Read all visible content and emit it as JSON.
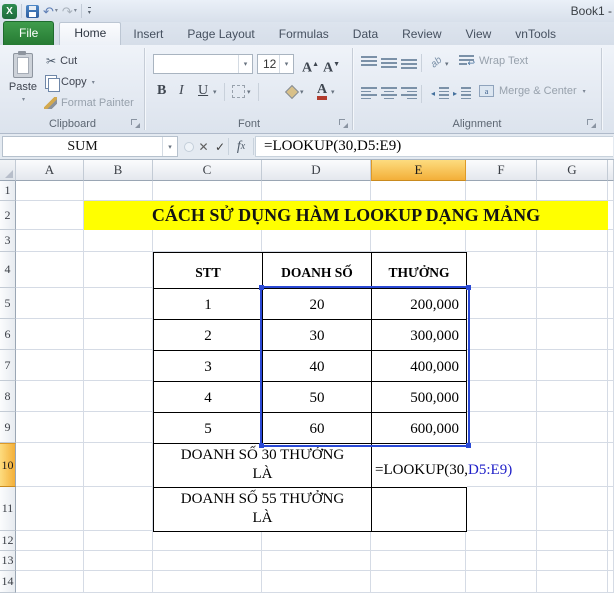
{
  "window": {
    "title": "Book1 -"
  },
  "icons": {
    "excel_logo": "X",
    "save": "floppy-disk",
    "undo": "↶",
    "redo": "↷",
    "qat_dropdown": "▾",
    "dropdown": "▾",
    "scissors": "✂",
    "cancel": "✕",
    "enter": "✓",
    "function": "fx",
    "bold": "B",
    "italic": "I",
    "underline": "U"
  },
  "tabs": {
    "items": [
      {
        "label": "File",
        "file": true,
        "active": false
      },
      {
        "label": "Home",
        "file": false,
        "active": true
      },
      {
        "label": "Insert",
        "file": false,
        "active": false
      },
      {
        "label": "Page Layout",
        "file": false,
        "active": false
      },
      {
        "label": "Formulas",
        "file": false,
        "active": false
      },
      {
        "label": "Data",
        "file": false,
        "active": false
      },
      {
        "label": "Review",
        "file": false,
        "active": false
      },
      {
        "label": "View",
        "file": false,
        "active": false
      },
      {
        "label": "vnTools",
        "file": false,
        "active": false
      }
    ]
  },
  "ribbon": {
    "clipboard": {
      "label": "Clipboard",
      "paste": "Paste",
      "cut": "Cut",
      "copy": "Copy",
      "format_painter": "Format Painter"
    },
    "font": {
      "label": "Font",
      "size_value": "12",
      "name_value": ""
    },
    "alignment": {
      "label": "Alignment",
      "wrap_text": "Wrap Text",
      "merge_center": "Merge & Center",
      "orientation": "ab"
    }
  },
  "formula_bar": {
    "name_box": "SUM",
    "formula": "=LOOKUP(30,D5:E9)"
  },
  "sheet": {
    "column_headers": [
      "A",
      "B",
      "C",
      "D",
      "E",
      "F",
      "G"
    ],
    "row_headers": [
      "1",
      "2",
      "3",
      "4",
      "5",
      "6",
      "7",
      "8",
      "9",
      "10",
      "11",
      "12",
      "13",
      "14"
    ],
    "active_column": "E",
    "active_row": "10",
    "highlight_range": "D5:E9",
    "banner": {
      "text": "CÁCH SỬ DỤNG HÀM LOOKUP DẠNG MẢNG",
      "bg_color": "#FFFF00",
      "text_color": "#141414"
    },
    "table": {
      "headers": [
        "STT",
        "DOANH SỐ",
        "THƯỞNG"
      ],
      "rows": [
        [
          "1",
          "20",
          "200,000"
        ],
        [
          "2",
          "30",
          "300,000"
        ],
        [
          "3",
          "40",
          "400,000"
        ],
        [
          "4",
          "50",
          "500,000"
        ],
        [
          "5",
          "60",
          "600,000"
        ]
      ],
      "label_rows": [
        {
          "lines": [
            "DOANH SỐ 30 THƯỞNG",
            "LÀ"
          ]
        },
        {
          "lines": [
            "DOANH SỐ 55 THƯỞNG",
            "LÀ"
          ]
        }
      ],
      "formula_cell": {
        "prefix": "=LOOKUP(30,",
        "reference": "D5:E9",
        "suffix": ")"
      }
    },
    "colors": {
      "selection_border": "#2A49D5",
      "reference_text": "#2020C8",
      "gridline": "#D5DBE5",
      "header_highlight_top": "#FDDC7F",
      "header_highlight_bottom": "#F3AF39"
    }
  }
}
